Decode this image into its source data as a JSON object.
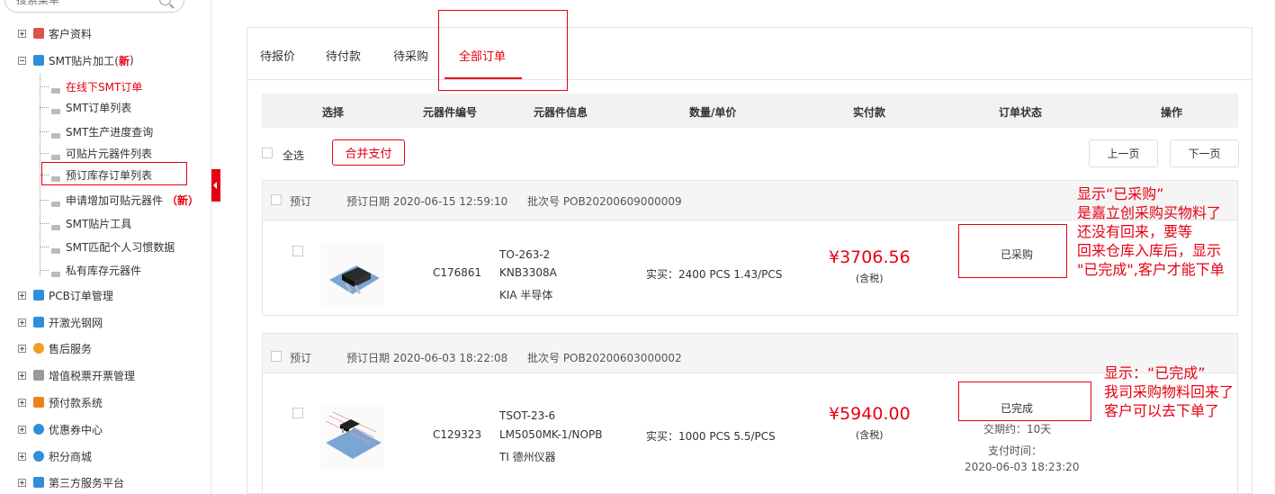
{
  "search": {
    "placeholder": "搜索菜单"
  },
  "sidebar": {
    "groups": [
      {
        "label": "客户资料",
        "color": "#d9534f"
      },
      {
        "label": "SMT贴片加工(",
        "new": "新",
        "close": ")",
        "color": "#2f8fd8"
      },
      {
        "label": "PCB订单管理",
        "color": "#2f8fd8"
      },
      {
        "label": "开激光钢网",
        "color": "#2f8fd8"
      },
      {
        "label": "售后服务",
        "color": "#f0a020"
      },
      {
        "label": "增值税票开票管理",
        "color": "#999999"
      },
      {
        "label": "预付款系统",
        "color": "#f08020"
      },
      {
        "label": "优惠券中心",
        "color": "#2f8fd8"
      },
      {
        "label": "积分商城",
        "color": "#2f8fd8"
      },
      {
        "label": "第三方服务平台",
        "color": "#2f8fd8"
      }
    ],
    "sub_items": [
      {
        "label": "在线下SMT订单"
      },
      {
        "label": "SMT订单列表"
      },
      {
        "label": "SMT生产进度查询"
      },
      {
        "label": "可贴片元器件列表"
      },
      {
        "label": "预订库存订单列表"
      },
      {
        "label": "申请增加可贴元器件",
        "new": "（新）"
      },
      {
        "label": "SMT贴片工具"
      },
      {
        "label": "SMT匹配个人习惯数据"
      },
      {
        "label": "私有库存元器件"
      }
    ]
  },
  "tabs": [
    "待报价",
    "待付款",
    "待采购",
    "全部订单"
  ],
  "columns": [
    "选择",
    "元器件编号",
    "元器件信息",
    "数量/单价",
    "实付款",
    "订单状态",
    "操作"
  ],
  "toolbar": {
    "select_all": "全选",
    "merge_pay": "合并支付",
    "prev_page": "上一页",
    "next_page": "下一页"
  },
  "orders": [
    {
      "type": "预订",
      "date": "预订日期 2020-06-15 12:59:10",
      "batch": "批次号  POB20200609000009",
      "code": "C176861",
      "package": "TO-263-2",
      "model": "KNB3308A",
      "brand": "KIA 半导体",
      "qty_price": "实买：2400 PCS    1.43/PCS",
      "amount": "¥3706.56",
      "tax": "(含税)",
      "status": "已采购"
    },
    {
      "type": "预订",
      "date": "预订日期 2020-06-03 18:22:08",
      "batch": "批次号  POB20200603000002",
      "code": "C129323",
      "package": "TSOT-23-6",
      "model": "LM5050MK-1/NOPB",
      "brand": "TI 德州仪器",
      "qty_price": "实买：1000 PCS    5.5/PCS",
      "amount": "¥5940.00",
      "tax": "(含税)",
      "status": "已完成",
      "delivery": "交期约：10天",
      "pay_label": "支付时间：",
      "pay_time": "2020-06-03 18:23:20"
    }
  ],
  "annotations": {
    "first": [
      "显示“已采购”",
      "是嘉立创采购买物料了",
      "还没有回来，要等",
      "回来仓库入库后，显示",
      "\"已完成\",客户才能下单"
    ],
    "second": [
      "显示：“已完成”",
      "我司采购物料回来了",
      "客户可以去下单了"
    ]
  },
  "colors": {
    "accent": "#e60012"
  }
}
